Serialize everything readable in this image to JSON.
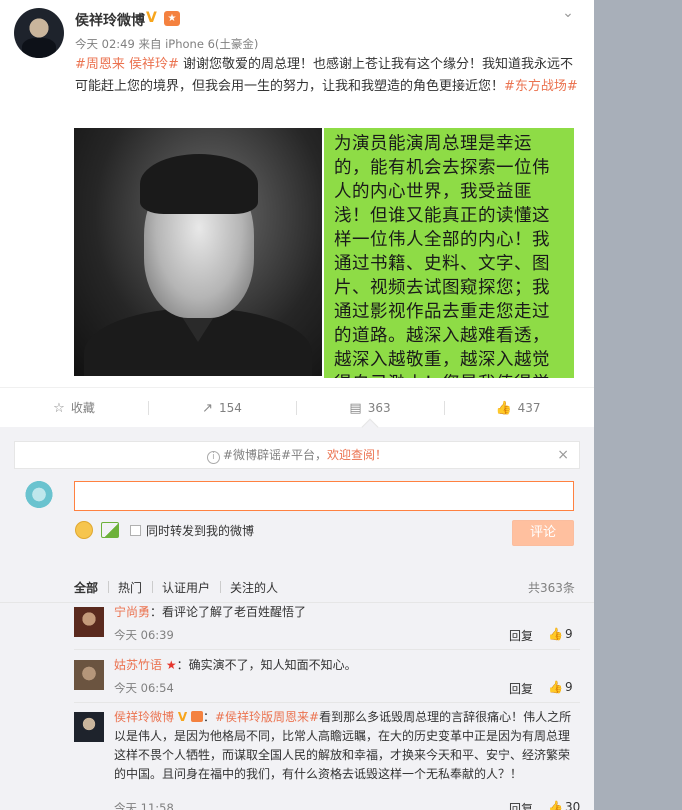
{
  "post": {
    "author": "侯祥玲微博",
    "verified_mark": "V",
    "medal_glyph": "★",
    "collapse_glyph": "⌄",
    "meta": "今天 02:49 来自 iPhone 6(土豪金)",
    "tag1": "#周恩来 侯祥玲#",
    "text_a": " 谢谢您敬爱的周总理！也感谢上苍让我有这个缘分！我知道我永远不可能赶上您的境界，但我会用一生的努力，让我和我塑造的角色更接近您！",
    "tag2": "#东方战场#",
    "image_text": "为演员能演周总理是幸运的，能有机会去探索一位伟人的内心世界，我受益匪浅！但谁又能真正的读懂这样一位伟人全部的内心！我通过书籍、史料、文字、图片、视频去试图窥探您；我通过影视作品去重走您走过的道路。越深入越难看透，越深入越敬重，越深入越觉得自己渺小！您是我值得学习一"
  },
  "actions": {
    "favorite_icon": "☆",
    "favorite": "收藏",
    "repost_icon": "↗",
    "repost": "154",
    "comment_icon": "▤",
    "comment": "363",
    "like_icon": "👍",
    "like": "437"
  },
  "notice": {
    "info_icon": "i",
    "prefix": "#微博辟谣#平台，",
    "highlight": "欢迎查阅！",
    "close": "×"
  },
  "composer": {
    "input_value": "",
    "forward_label": "同时转发到我的微博",
    "submit": "评论"
  },
  "tabs": {
    "all": "全部",
    "hot": "热门",
    "verified": "认证用户",
    "following": "关注的人",
    "total": "共363条"
  },
  "comments": [
    {
      "user": "宁尚勇",
      "text": "：看评论了解了老百姓醒悟了",
      "time": "今天 06:39",
      "reply": "回复",
      "likes": "9"
    },
    {
      "user": "姑苏竹语",
      "star": "★",
      "text": "：确实演不了，知人知面不知心。",
      "time": "今天 06:54",
      "reply": "回复",
      "likes": "9"
    },
    {
      "user": "侯祥玲微博",
      "verified_mark": "V",
      "tag": "#侯祥玲版周恩来#",
      "text_line1": "看到那么多诋毁周总理的言辞很痛心！伟人之所",
      "text_rest": "以是伟人，是因为他格局不同，比常人高瞻远瞩，在大的历史变革中正是因为有周总理这样不畏个人牺牲，而谋取全国人民的解放和幸福，才换来今天和平、安宁、经济繁荣的中国。且问身在福中的我们，有什么资格去诋毁这样一个无私奉献的人？！",
      "time": "今天 11:58",
      "reply": "回复",
      "likes": "30"
    }
  ],
  "colors": {
    "accent": "#eb7350",
    "green_panel": "#8edc46",
    "submit_disabled": "#ffc09f",
    "sidebar": "#a8afb9"
  }
}
